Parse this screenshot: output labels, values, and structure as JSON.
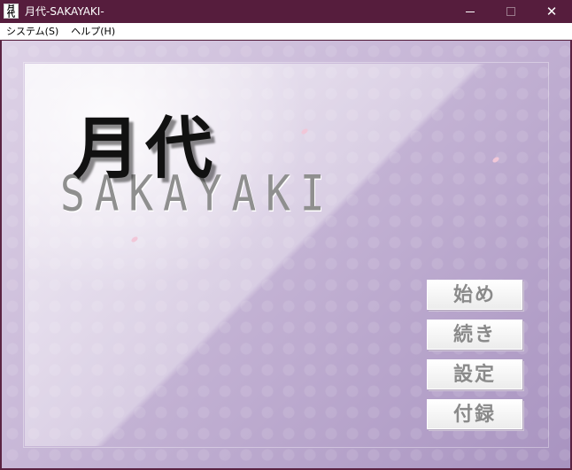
{
  "window": {
    "title": "月代-SAKAYAKI-",
    "icon_label": "月代",
    "close_label": "✕"
  },
  "menubar": {
    "items": [
      {
        "label": "システム(S)"
      },
      {
        "label": "ヘルプ(H)"
      }
    ]
  },
  "game": {
    "logo_kanji": "月代",
    "logo_sub": "SAKAYAKI",
    "menu": [
      {
        "label": "始め"
      },
      {
        "label": "続き"
      },
      {
        "label": "設定"
      },
      {
        "label": "付録"
      }
    ]
  },
  "colors": {
    "titlebar": "#561d3d",
    "background_purple": "#a893c0"
  }
}
